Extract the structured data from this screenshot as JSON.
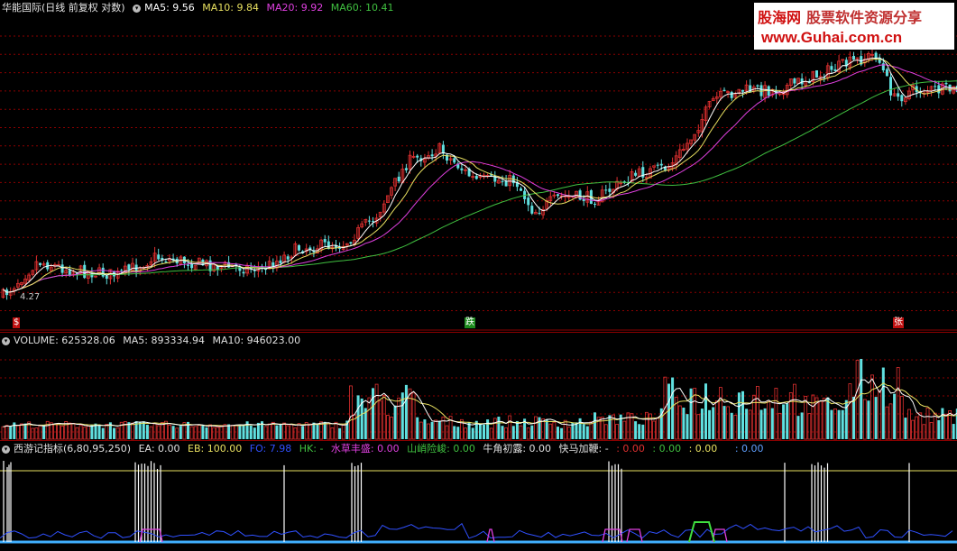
{
  "price_pane": {
    "stock_name": "华能国际",
    "period_info": "(日线 前复权 对数)",
    "ma5": "MA5: 9.56",
    "ma10": "MA10: 9.84",
    "ma20": "MA20: 9.92",
    "ma60": "MA60: 10.41",
    "low_marker": "4.27",
    "signal_start": "$",
    "signal_drop": "跌",
    "signal_rise": "张"
  },
  "watermark": {
    "brand": "股海网",
    "tagline": "股票软件资源分享",
    "url": "www.Guhai.com.cn"
  },
  "volume_pane": {
    "volume": "VOLUME: 625328.06",
    "ma5": "MA5: 893334.94",
    "ma10": "MA10: 946023.00"
  },
  "indicator_pane": {
    "name": "西游记指标(6,80,95,250)",
    "ea": "EA: 0.00",
    "eb": "EB: 100.00",
    "fo": "FO: 7.98",
    "hk": "HK: -",
    "shuicao": "水草丰盛: 0.00",
    "shanluan": "山峭险峻: 0.00",
    "niujiao": "牛角初露: 0.00",
    "kuaima": "快马加鞭: -",
    "x1": ": 0.00",
    "x2": ": 0.00",
    "x3": ": 0.00",
    "x4": ": 0.00"
  },
  "colors": {
    "up": "#e03030",
    "down": "#60e0e0",
    "ma5": "#ffffff",
    "ma10": "#e8e060",
    "ma20": "#e040e0",
    "ma60": "#40c040",
    "grid": "#8b0000"
  },
  "icons": [
    "menu-dot-icon"
  ]
}
